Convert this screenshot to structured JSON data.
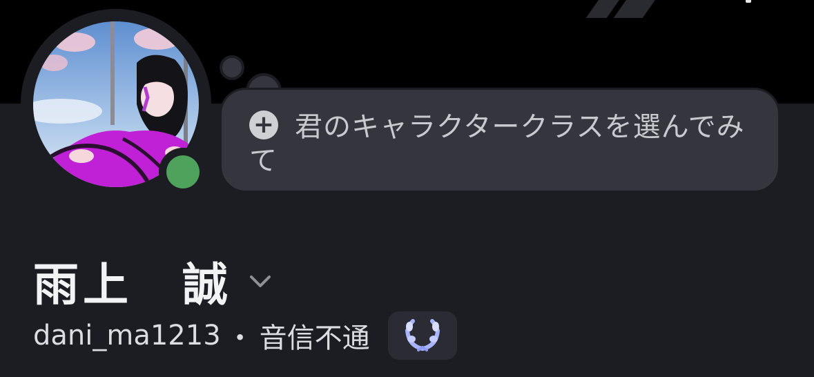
{
  "profile": {
    "display_name": "雨上　誠",
    "username": "dani_ma1213",
    "separator": "・",
    "pronouns": "音信不通",
    "status": "online",
    "status_color": "#4fa25c"
  },
  "custom_status_prompt": {
    "icon": "plus-icon",
    "text": "君のキャラクタークラスを選んでみて"
  },
  "icons": {
    "name_dropdown": "chevron-down-icon",
    "badge": "laurel-wreath-icon"
  },
  "colors": {
    "background": "#1c1d22",
    "banner": "#000000",
    "bubble": "#35363d",
    "text_primary": "#f2f3f5",
    "text_secondary": "#dcdde1",
    "badge_accent": "#a9b4ff"
  }
}
